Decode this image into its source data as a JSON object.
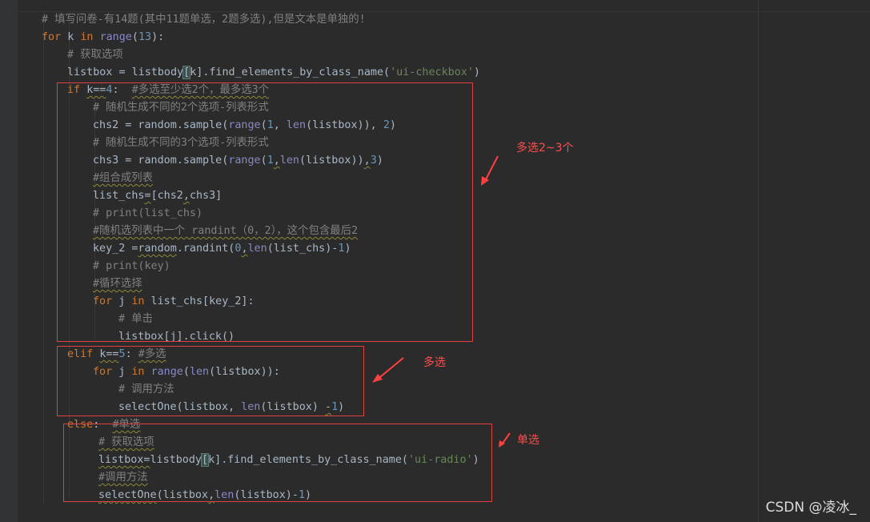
{
  "editor": {
    "lines": [
      {
        "id": "l01",
        "t": "# 填写问卷-有14题(其中11题单选，2题多选),但是文本是单独的!"
      },
      {
        "id": "l02",
        "t": "for k in range(13):"
      },
      {
        "id": "l03",
        "t": "# 获取选项"
      },
      {
        "id": "l04",
        "t": "listbox = listbody[k].find_elements_by_class_name('ui-checkbox')"
      },
      {
        "id": "l05",
        "t": "if k==4:  #多选至少选2个，最多选3个"
      },
      {
        "id": "l06",
        "t": "# 随机生成不同的2个选项-列表形式"
      },
      {
        "id": "l07",
        "t": "chs2 = random.sample(range(1, len(listbox)), 2)"
      },
      {
        "id": "l08",
        "t": "# 随机生成不同的3个选项-列表形式"
      },
      {
        "id": "l09",
        "t": "chs3 = random.sample(range(1,len(listbox)),3)"
      },
      {
        "id": "l10",
        "t": "#组合成列表"
      },
      {
        "id": "l11",
        "t": "list_chs=[chs2,chs3]"
      },
      {
        "id": "l12",
        "t": "# print(list_chs)"
      },
      {
        "id": "l13",
        "t": "#随机选列表中一个 randint（0，2），这个包含最后2"
      },
      {
        "id": "l14",
        "t": "key_2 =random.randint(0,len(list_chs)-1)"
      },
      {
        "id": "l15",
        "t": "# print(key)"
      },
      {
        "id": "l16",
        "t": "#循环选择"
      },
      {
        "id": "l17",
        "t": "for j in list_chs[key_2]:"
      },
      {
        "id": "l18",
        "t": "# 单击"
      },
      {
        "id": "l19",
        "t": "listbox[j].click()"
      },
      {
        "id": "l20",
        "t": "elif k==5: #多选"
      },
      {
        "id": "l21",
        "t": "for j in range(len(listbox)):"
      },
      {
        "id": "l22",
        "t": "# 调用方法"
      },
      {
        "id": "l23",
        "t": "selectOne(listbox, len(listbox) -1)"
      },
      {
        "id": "l24",
        "t": "else:  #单选"
      },
      {
        "id": "l25",
        "t": "# 获取选项"
      },
      {
        "id": "l26",
        "t": "listbox=listbody[k].find_elements_by_class_name('ui-radio')"
      },
      {
        "id": "l27",
        "t": "#调用方法"
      },
      {
        "id": "l28",
        "t": "selectOne(listbox,len(listbox)-1)"
      }
    ]
  },
  "annotations": {
    "multi_2_3": "多选2~3个",
    "multi": "多选",
    "single": "单选"
  },
  "colors": {
    "background": "#2b2b2b",
    "keyword": "#cc7832",
    "builtin": "#8888c6",
    "number": "#6897bb",
    "string": "#6a8759",
    "comment": "#808080",
    "annotation": "#ff4d4d"
  },
  "watermark": "CSDN @凌冰_"
}
